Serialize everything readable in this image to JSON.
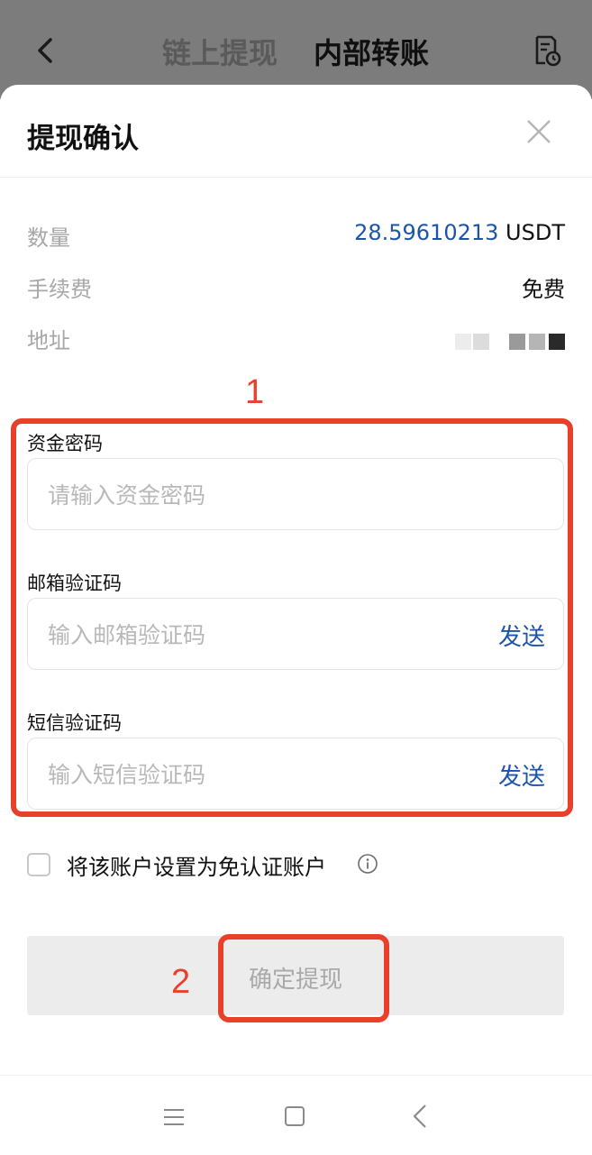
{
  "header": {
    "tabs": [
      {
        "label": "链上提现"
      },
      {
        "label": "内部转账"
      }
    ]
  },
  "sheet": {
    "title": "提现确认",
    "info": {
      "amount_label": "数量",
      "amount_value": "28.59610213",
      "amount_unit": "USDT",
      "fee_label": "手续费",
      "fee_value": "免费",
      "address_label": "地址"
    },
    "annotations": {
      "box1_number": "1",
      "box2_number": "2",
      "color": "#e8402b"
    },
    "fields": [
      {
        "label": "资金密码",
        "placeholder": "请输入资金密码",
        "value": ""
      },
      {
        "label": "邮箱验证码",
        "placeholder": "输入邮箱验证码",
        "value": "",
        "action": "发送"
      },
      {
        "label": "短信验证码",
        "placeholder": "输入短信验证码",
        "value": "",
        "action": "发送"
      }
    ],
    "checkbox": {
      "label": "将该账户设置为免认证账户",
      "checked": false
    },
    "confirm_button": "确定提现"
  },
  "colors": {
    "accent": "#1c55a8",
    "overlay": "#7c7c7c",
    "button_disabled_bg": "#ececec"
  },
  "icons": {
    "back": "chevron-left-icon",
    "record": "document-clock-icon",
    "close": "close-icon",
    "info": "info-circle-icon"
  }
}
